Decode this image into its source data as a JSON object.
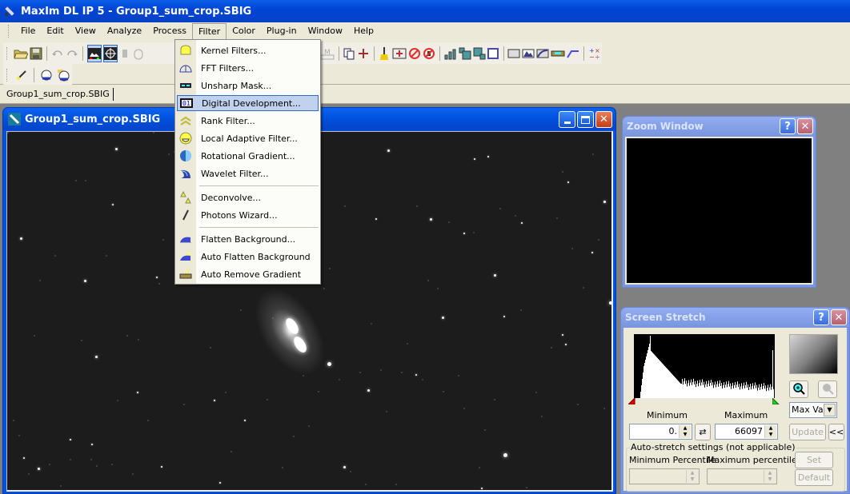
{
  "app": {
    "title": "MaxIm DL IP 5 - Group1_sum_crop.SBIG"
  },
  "menubar": {
    "items": [
      {
        "label": "File",
        "open": false
      },
      {
        "label": "Edit",
        "open": false
      },
      {
        "label": "View",
        "open": false
      },
      {
        "label": "Analyze",
        "open": false
      },
      {
        "label": "Process",
        "open": false
      },
      {
        "label": "Filter",
        "open": true
      },
      {
        "label": "Color",
        "open": false
      },
      {
        "label": "Plug-in",
        "open": false
      },
      {
        "label": "Window",
        "open": false
      },
      {
        "label": "Help",
        "open": false
      }
    ]
  },
  "toolbar": {
    "row1_icons": [
      "open-folder-icon",
      "save-icon",
      "undo-icon",
      "redo-icon",
      "screen-stretch-icon",
      "crosshair-icon",
      "hand-icon",
      "mouse-icon",
      "ruler-icon",
      "multi-ruler-icon",
      "ruler-doc-icon",
      "ruler-pin-icon",
      "ruler-m-icon",
      "copy-icon",
      "plus-icon",
      "brush-icon",
      "remove-hot-pixel-icon",
      "no-bloom-icon",
      "no-column-icon",
      "histogram-icon",
      "bin-up-icon",
      "bin-down-icon",
      "frame-icon",
      "gradient-box-icon",
      "histogram-shape-icon",
      "curve-box-icon",
      "level-icon",
      "curve-line-icon",
      "arithmetic-icon"
    ],
    "row2_icons": [
      "wand-icon",
      "globe-icon",
      "globe-folder-icon"
    ]
  },
  "tabs": [
    {
      "label": "Group1_sum_crop.SBIG",
      "active": true
    }
  ],
  "image_window": {
    "title": "Group1_sum_crop.SBIG"
  },
  "filter_menu": {
    "items": [
      {
        "label": "Kernel Filters...",
        "icon": "kernel-filter-icon",
        "highlighted": false
      },
      {
        "label": "FFT Filters...",
        "icon": "fft-filter-icon",
        "highlighted": false
      },
      {
        "label": "Unsharp Mask...",
        "icon": "unsharp-mask-icon",
        "highlighted": false
      },
      {
        "label": "Digital Development...",
        "icon": "digital-development-icon",
        "highlighted": true
      },
      {
        "label": "Rank Filter...",
        "icon": "rank-filter-icon",
        "highlighted": false
      },
      {
        "label": "Local Adaptive Filter...",
        "icon": "local-adaptive-icon",
        "highlighted": false
      },
      {
        "label": "Rotational Gradient...",
        "icon": "rotational-gradient-icon",
        "highlighted": false
      },
      {
        "label": "Wavelet Filter...",
        "icon": "wavelet-filter-icon",
        "highlighted": false
      },
      {
        "label": "Deconvolve...",
        "icon": "deconvolve-icon",
        "highlighted": false
      },
      {
        "label": "Photons Wizard...",
        "icon": "photons-wizard-icon",
        "highlighted": false
      },
      {
        "label": "Flatten Background...",
        "icon": "flatten-background-icon",
        "highlighted": false
      },
      {
        "label": "Auto Flatten Background",
        "icon": "auto-flatten-icon",
        "highlighted": false
      },
      {
        "label": "Auto Remove Gradient",
        "icon": "auto-remove-gradient-icon",
        "highlighted": false
      }
    ]
  },
  "zoom_window": {
    "title": "Zoom Window",
    "help": "?",
    "close": "✕"
  },
  "screen_stretch": {
    "title": "Screen Stretch",
    "help": "?",
    "close": "✕",
    "minimum_label": "Minimum",
    "maximum_label": "Maximum",
    "minimum_value": "0.",
    "maximum_value": "66097",
    "mode_select": "Max Val",
    "update_button": "Update",
    "collapse_button": "<<",
    "swap_icon": "⇄",
    "autostretch_legend": "Auto-stretch settings (not applicable)",
    "min_percentile_label": "Minimum Percentile",
    "max_percentile_label": "Maximum percentile",
    "min_percentile_value": "",
    "max_percentile_value": "",
    "set_button": "Set",
    "default_button": "Default"
  },
  "colors": {
    "title_blue": "#0054e3",
    "menu_bg": "#ece9d8",
    "highlight": "#c1d2ee",
    "highlight_border": "#316ac5",
    "tool_caption": "#7a96df"
  }
}
